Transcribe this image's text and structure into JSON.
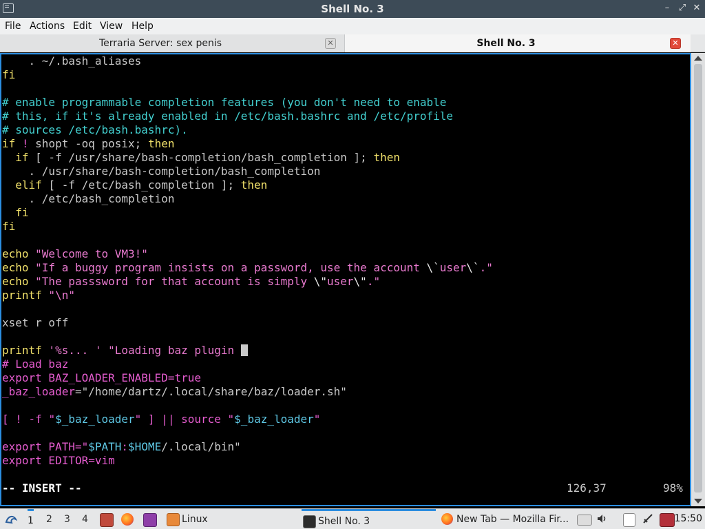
{
  "window": {
    "title": "Shell No. 3",
    "controls": {
      "minimize": "–",
      "restore": "⤢",
      "close": "✕"
    }
  },
  "menubar": {
    "items": [
      "File",
      "Actions",
      "Edit",
      "View",
      "Help"
    ]
  },
  "tabs": [
    {
      "label": "Terraria Server: sex penis",
      "active": false,
      "close": "✕"
    },
    {
      "label": "Shell No. 3",
      "active": true,
      "close": "✕"
    }
  ],
  "editor": {
    "lines": [
      [
        {
          "t": "    . ~/.bash_aliases",
          "c": ""
        }
      ],
      [
        {
          "t": "fi",
          "c": "kw"
        }
      ],
      [
        {
          "t": "",
          "c": ""
        }
      ],
      [
        {
          "t": "# enable programmable completion features (you don't need to enable",
          "c": "com"
        }
      ],
      [
        {
          "t": "# this, if it's already enabled in /etc/bash.bashrc and /etc/profile",
          "c": "com"
        }
      ],
      [
        {
          "t": "# sources /etc/bash.bashrc).",
          "c": "com"
        }
      ],
      [
        {
          "t": "if",
          "c": "kw"
        },
        {
          "t": " ! ",
          "c": "pk"
        },
        {
          "t": "shopt -oq posix; ",
          "c": ""
        },
        {
          "t": "then",
          "c": "kw"
        }
      ],
      [
        {
          "t": "  if",
          "c": "kw"
        },
        {
          "t": " [ -f /usr/share/bash-completion/bash_completion ]; ",
          "c": ""
        },
        {
          "t": "then",
          "c": "kw"
        }
      ],
      [
        {
          "t": "    . /usr/share/bash-completion/bash_completion",
          "c": ""
        }
      ],
      [
        {
          "t": "  elif",
          "c": "kw"
        },
        {
          "t": " [ -f /etc/bash_completion ]; ",
          "c": ""
        },
        {
          "t": "then",
          "c": "kw"
        }
      ],
      [
        {
          "t": "    . /etc/bash_completion",
          "c": ""
        }
      ],
      [
        {
          "t": "  fi",
          "c": "kw"
        }
      ],
      [
        {
          "t": "fi",
          "c": "kw"
        }
      ],
      [
        {
          "t": "",
          "c": ""
        }
      ],
      [
        {
          "t": "echo",
          "c": "kw"
        },
        {
          "t": " \"Welcome to VM3!\"",
          "c": "str"
        }
      ],
      [
        {
          "t": "echo",
          "c": "kw"
        },
        {
          "t": " \"If a buggy program insists on a password, use the account ",
          "c": "str"
        },
        {
          "t": "\\`",
          "c": "wt"
        },
        {
          "t": "user",
          "c": "str"
        },
        {
          "t": "\\`",
          "c": "wt"
        },
        {
          "t": ".\"",
          "c": "str"
        }
      ],
      [
        {
          "t": "echo",
          "c": "kw"
        },
        {
          "t": " \"The passsword for that account is simply ",
          "c": "str"
        },
        {
          "t": "\\\"",
          "c": "wt"
        },
        {
          "t": "user",
          "c": "str"
        },
        {
          "t": "\\\"",
          "c": "wt"
        },
        {
          "t": ".\"",
          "c": "str"
        }
      ],
      [
        {
          "t": "printf",
          "c": "kw"
        },
        {
          "t": " \"\\n\"",
          "c": "str"
        }
      ],
      [
        {
          "t": "",
          "c": ""
        }
      ],
      [
        {
          "t": "xset r off",
          "c": ""
        }
      ],
      [
        {
          "t": "",
          "c": ""
        }
      ],
      [
        {
          "t": "printf",
          "c": "kw"
        },
        {
          "t": " '%s... ' \"Loading baz plugin ",
          "c": "str"
        },
        {
          "t": "",
          "c": "cursor"
        }
      ],
      [
        {
          "t": "# Load baz",
          "c": "pk"
        }
      ],
      [
        {
          "t": "export",
          "c": "pk"
        },
        {
          "t": " BAZ_LOADER_ENABLED=true",
          "c": "pk"
        }
      ],
      [
        {
          "t": "_baz_loader",
          "c": "pk"
        },
        {
          "t": "=\"/home/dartz/.local/share/baz/loader.sh\"",
          "c": ""
        }
      ],
      [
        {
          "t": "",
          "c": ""
        }
      ],
      [
        {
          "t": "[ ! -f ",
          "c": "pk"
        },
        {
          "t": "\"",
          "c": "pk"
        },
        {
          "t": "$_baz_loader",
          "c": "cy"
        },
        {
          "t": "\" ] || ",
          "c": "pk"
        },
        {
          "t": "source",
          "c": "pk"
        },
        {
          "t": " \"",
          "c": "pk"
        },
        {
          "t": "$_baz_loader",
          "c": "cy"
        },
        {
          "t": "\"",
          "c": "pk"
        }
      ],
      [
        {
          "t": "",
          "c": ""
        }
      ],
      [
        {
          "t": "export",
          "c": "pk"
        },
        {
          "t": " PATH=\"",
          "c": "pk"
        },
        {
          "t": "$PATH",
          "c": "cy"
        },
        {
          "t": ":",
          "c": "pk"
        },
        {
          "t": "$HOME",
          "c": "cy"
        },
        {
          "t": "/.local/bin\"",
          "c": ""
        }
      ],
      [
        {
          "t": "export",
          "c": "pk"
        },
        {
          "t": " EDITOR=vim",
          "c": "pk"
        }
      ],
      [
        {
          "t": "",
          "c": ""
        }
      ]
    ],
    "status": {
      "mode": "-- INSERT --",
      "position": "126,37",
      "percent": "98%"
    }
  },
  "taskbar": {
    "workspaces": [
      "1",
      "2",
      "3",
      "4"
    ],
    "tasks": [
      {
        "label": "Linux",
        "icon": "folder-icon"
      },
      {
        "label": "Shell No. 3",
        "icon": "terminal-icon"
      },
      {
        "label": "New Tab — Mozilla Fir...",
        "icon": "firefox-icon"
      }
    ],
    "clock": "15:50"
  },
  "colors": {
    "accent": "#2b8de0",
    "comment": "#43d0d0",
    "keyword": "#f0e06a",
    "string": "#e97acf",
    "variable": "#5fc9e6"
  }
}
